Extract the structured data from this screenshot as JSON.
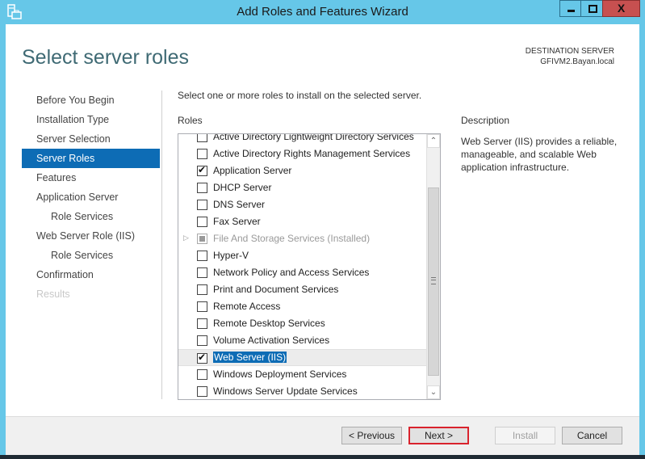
{
  "window": {
    "title": "Add Roles and Features Wizard",
    "controls": {
      "minimize": "minimize",
      "maximize": "maximize",
      "close": "X"
    }
  },
  "header": {
    "page_title": "Select server roles",
    "destination_label": "DESTINATION SERVER",
    "destination_server": "GFIVM2.Bayan.local"
  },
  "nav": {
    "items": [
      {
        "label": "Before You Begin",
        "state": "normal"
      },
      {
        "label": "Installation Type",
        "state": "normal"
      },
      {
        "label": "Server Selection",
        "state": "normal"
      },
      {
        "label": "Server Roles",
        "state": "active"
      },
      {
        "label": "Features",
        "state": "normal"
      },
      {
        "label": "Application Server",
        "state": "normal"
      },
      {
        "label": "Role Services",
        "state": "sub"
      },
      {
        "label": "Web Server Role (IIS)",
        "state": "normal"
      },
      {
        "label": "Role Services",
        "state": "sub"
      },
      {
        "label": "Confirmation",
        "state": "normal"
      },
      {
        "label": "Results",
        "state": "disabled"
      }
    ]
  },
  "main": {
    "instruction": "Select one or more roles to install on the selected server.",
    "roles_label": "Roles",
    "roles": [
      {
        "label": "Active Directory Lightweight Directory Services",
        "checked": false
      },
      {
        "label": "Active Directory Rights Management Services",
        "checked": false
      },
      {
        "label": "Application Server",
        "checked": true
      },
      {
        "label": "DHCP Server",
        "checked": false
      },
      {
        "label": "DNS Server",
        "checked": false
      },
      {
        "label": "Fax Server",
        "checked": false
      },
      {
        "label": "File And Storage Services (Installed)",
        "checked": "partial",
        "disabled": true,
        "expandable": true
      },
      {
        "label": "Hyper-V",
        "checked": false
      },
      {
        "label": "Network Policy and Access Services",
        "checked": false
      },
      {
        "label": "Print and Document Services",
        "checked": false
      },
      {
        "label": "Remote Access",
        "checked": false
      },
      {
        "label": "Remote Desktop Services",
        "checked": false
      },
      {
        "label": "Volume Activation Services",
        "checked": false
      },
      {
        "label": "Web Server (IIS)",
        "checked": true,
        "selected": true
      },
      {
        "label": "Windows Deployment Services",
        "checked": false
      },
      {
        "label": "Windows Server Update Services",
        "checked": false
      }
    ],
    "description_title": "Description",
    "description_text": "Web Server (IIS) provides a reliable, manageable, and scalable Web application infrastructure."
  },
  "footer": {
    "previous_label": "< Previous",
    "next_label": "Next >",
    "install_label": "Install",
    "cancel_label": "Cancel"
  },
  "colors": {
    "frame": "#66c7e8",
    "accent": "#0d6cb5",
    "close": "#c75050",
    "highlight_border": "#d9232d"
  }
}
